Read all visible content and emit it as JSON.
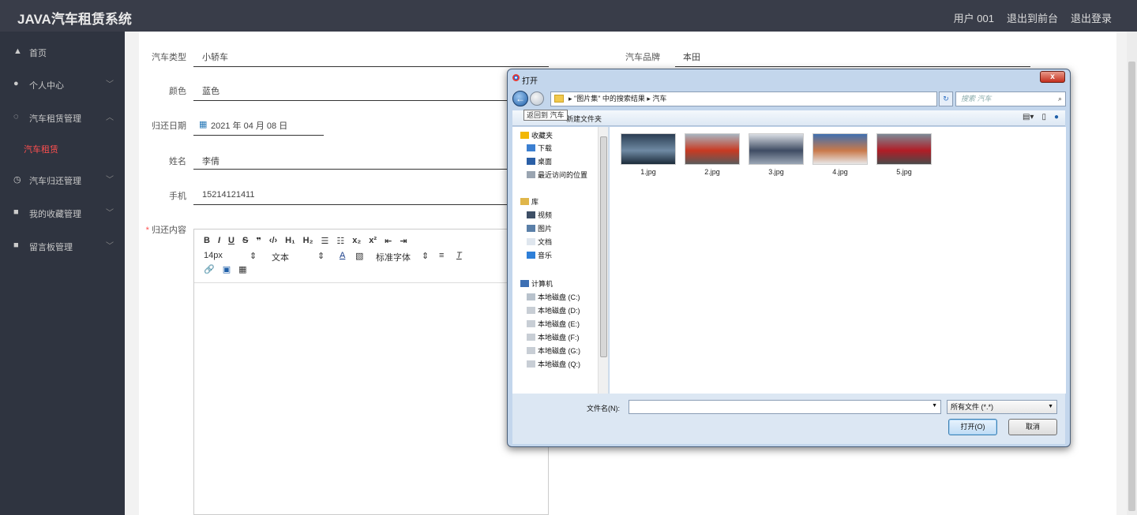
{
  "app": {
    "title": "JAVA汽车租赁系统"
  },
  "header": {
    "user": "用户 001",
    "to_front": "退出到前台",
    "logout": "退出登录"
  },
  "sidebar": {
    "items": [
      {
        "icon": "home-icon",
        "glyph": "▲",
        "label": "首页",
        "chevron": ""
      },
      {
        "icon": "user-icon",
        "glyph": "●",
        "label": "个人中心",
        "chevron": "﹀"
      },
      {
        "icon": "car-rental-icon",
        "glyph": "◌",
        "label": "汽车租赁管理",
        "chevron": "︿"
      },
      {
        "icon": "",
        "glyph": "",
        "label": "汽车租赁",
        "chevron": ""
      },
      {
        "icon": "clock-icon",
        "glyph": "◷",
        "label": "汽车归还管理",
        "chevron": "﹀"
      },
      {
        "icon": "favorite-icon",
        "glyph": "■",
        "label": "我的收藏管理",
        "chevron": "﹀"
      },
      {
        "icon": "message-icon",
        "glyph": "■",
        "label": "留言板管理",
        "chevron": "﹀"
      }
    ]
  },
  "form": {
    "car_type": {
      "label": "汽车类型",
      "value": "小轿车"
    },
    "car_brand": {
      "label": "汽车品牌",
      "value": "本田"
    },
    "color": {
      "label": "颜色",
      "value": "蓝色"
    },
    "return_date": {
      "label": "归还日期",
      "value": "2021 年 04 月 08 日"
    },
    "name": {
      "label": "姓名",
      "value": "李倩"
    },
    "phone": {
      "label": "手机",
      "value": "15214121411"
    },
    "content": {
      "required_mark": "*",
      "label": "归还内容"
    }
  },
  "editor": {
    "toolbar_row1": [
      "B",
      "I",
      "U",
      "S",
      "❞",
      "‹/›",
      "H₁",
      "H₂",
      "☰",
      "☷",
      "x₂",
      "x²",
      "⇤",
      "⇥"
    ],
    "font_size": "14px",
    "text_style": "文本",
    "font_family": "标准字体",
    "toolbar_row3": [
      "🔗",
      "▣",
      "▦"
    ]
  },
  "dialog": {
    "title": "打开",
    "close": "x",
    "address": "▸ \"图片集\" 中的搜索结果 ▸ 汽车",
    "search_placeholder": "搜索 汽车",
    "tooltip": "返回到 汽车",
    "new_folder": "新建文件夹",
    "tree": [
      {
        "label": "收藏夹",
        "icon": "star-icon",
        "color": "#f2b705"
      },
      {
        "label": "下载",
        "icon": "download-folder-icon",
        "color": "#3b7fd1"
      },
      {
        "label": "桌面",
        "icon": "desktop-icon",
        "color": "#2b5fa6"
      },
      {
        "label": "最近访问的位置",
        "icon": "recent-icon",
        "color": "#9aa5b1"
      },
      {
        "label": "库",
        "icon": "library-icon",
        "color": "#e0b64a"
      },
      {
        "label": "视频",
        "icon": "video-icon",
        "color": "#3d4f66"
      },
      {
        "label": "图片",
        "icon": "pictures-icon",
        "color": "#5a7fa8"
      },
      {
        "label": "文档",
        "icon": "documents-icon",
        "color": "#dfe6ee"
      },
      {
        "label": "音乐",
        "icon": "music-icon",
        "color": "#2e7fd8"
      },
      {
        "label": "计算机",
        "icon": "computer-icon",
        "color": "#3d6fb3"
      },
      {
        "label": "本地磁盘 (C:)",
        "icon": "drive-c-icon",
        "color": "#b8c2cc"
      },
      {
        "label": "本地磁盘 (D:)",
        "icon": "drive-icon",
        "color": "#c8ced5"
      },
      {
        "label": "本地磁盘 (E:)",
        "icon": "drive-icon",
        "color": "#c8ced5"
      },
      {
        "label": "本地磁盘 (F:)",
        "icon": "drive-icon",
        "color": "#c8ced5"
      },
      {
        "label": "本地磁盘 (G:)",
        "icon": "drive-icon",
        "color": "#c8ced5"
      },
      {
        "label": "本地磁盘 (Q:)",
        "icon": "drive-icon",
        "color": "#c8ced5"
      }
    ],
    "files": [
      {
        "name": "1.jpg",
        "colors": [
          "#2a3d52",
          "#6f8aa3",
          "#1c2b3a"
        ]
      },
      {
        "name": "2.jpg",
        "colors": [
          "#a8b5c0",
          "#c83a22",
          "#5b5b5b"
        ]
      },
      {
        "name": "3.jpg",
        "colors": [
          "#d9dde3",
          "#3f4c63",
          "#9aa6b5"
        ]
      },
      {
        "name": "4.jpg",
        "colors": [
          "#3f6fb0",
          "#c9794a",
          "#e8e8e8"
        ]
      },
      {
        "name": "5.jpg",
        "colors": [
          "#7c8a96",
          "#b11d26",
          "#4a4a4a"
        ]
      }
    ],
    "filename_label": "文件名(N):",
    "filename_value": "",
    "filetype": "所有文件 (*.*)",
    "open_btn": "打开(O)",
    "cancel_btn": "取消"
  }
}
